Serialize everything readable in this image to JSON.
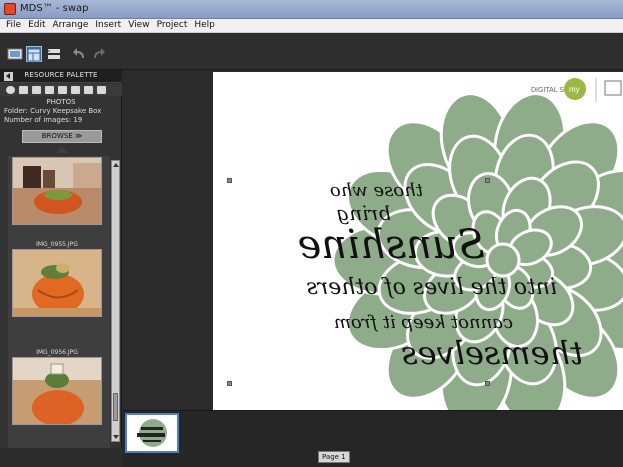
{
  "window": {
    "title": "MDS™ - swap"
  },
  "menu": [
    "File",
    "Edit",
    "Arrange",
    "Insert",
    "View",
    "Project",
    "Help"
  ],
  "toolbar": {
    "buttons": [
      "photo-tool-icon",
      "layout-icon",
      "swap-icon",
      "undo-icon",
      "redo-icon"
    ]
  },
  "palette": {
    "header": "RESOURCE PALETTE",
    "section": "PHOTOS",
    "folder": "Folder: Curvy Keepsake Box",
    "count": "Number of images: 19",
    "browse": "BROWSE  ≫",
    "thumbnails": [
      {
        "name": ""
      },
      {
        "name": "IMG_0955.JPG"
      },
      {
        "name": "IMG_0956.JPG"
      }
    ]
  },
  "canvas": {
    "logo_text": "DIGITAL STUDIO",
    "logo_badge": "my",
    "quote_lines": [
      "those who",
      "bring",
      "Sunshine",
      "into the lives of others",
      "cannot keep it from",
      "themselves"
    ],
    "flower_color": "#8fac8a"
  },
  "filmstrip": {
    "page_label": "Page 1"
  }
}
